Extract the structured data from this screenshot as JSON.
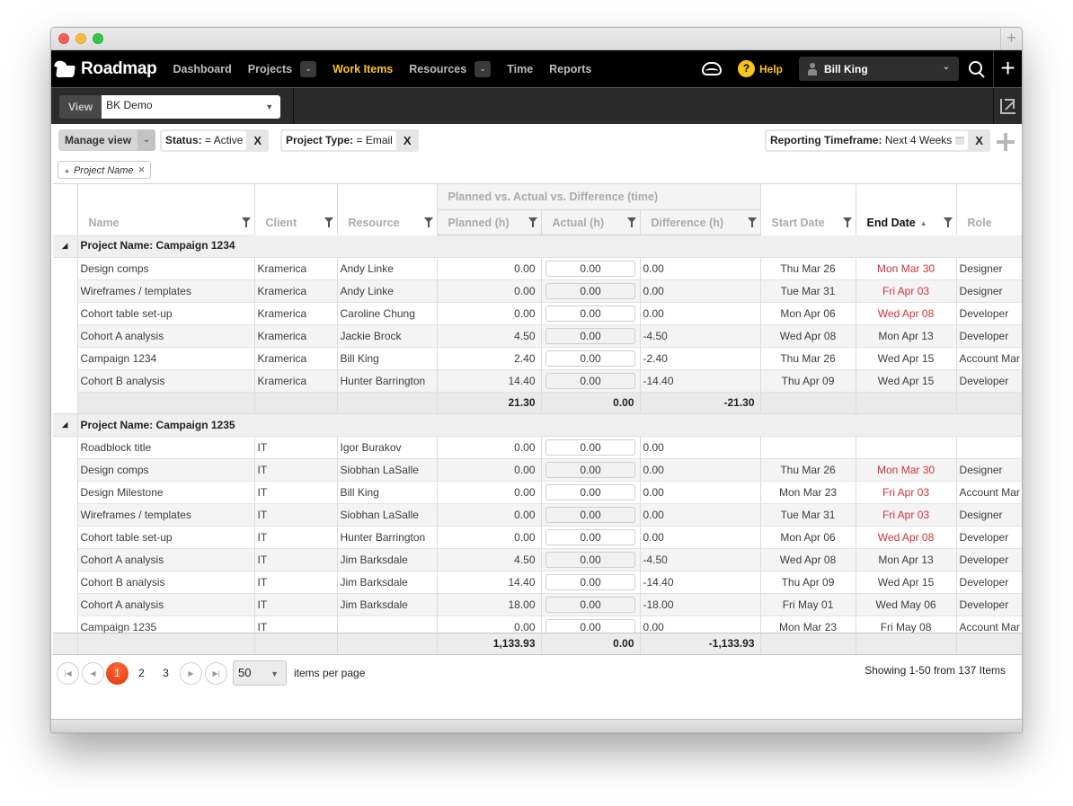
{
  "window": {
    "tab_plus": "+"
  },
  "nav": {
    "logo": "Roadmap",
    "items": [
      {
        "label": "Dashboard",
        "active": false,
        "dropdown": false
      },
      {
        "label": "Projects",
        "active": false,
        "dropdown": true
      },
      {
        "label": "Work Items",
        "active": true,
        "dropdown": false
      },
      {
        "label": "Resources",
        "active": false,
        "dropdown": true
      },
      {
        "label": "Time",
        "active": false,
        "dropdown": false
      },
      {
        "label": "Reports",
        "active": false,
        "dropdown": false
      }
    ],
    "help_badge": "?",
    "help_label": "Help",
    "user": "Bill King",
    "plus": "+",
    "colors": {
      "active": "#f8c51c",
      "bar": "#000000"
    }
  },
  "viewbar": {
    "label": "View",
    "selected": "BK Demo"
  },
  "filters": {
    "manage_view": "Manage view",
    "chips": [
      {
        "key": "Status:",
        "value": "= Active",
        "close": "X"
      },
      {
        "key": "Project Type:",
        "value": "= Email",
        "close": "X"
      },
      {
        "key": "Reporting Timeframe:",
        "value": "Next 4 Weeks",
        "close": "X"
      }
    ],
    "group_by": "Project Name",
    "group_close": "×"
  },
  "grid": {
    "group_header": "Planned vs. Actual vs. Difference (time)",
    "columns": {
      "name": "Name",
      "client": "Client",
      "resource": "Resource",
      "planned": "Planned (h)",
      "actual": "Actual (h)",
      "difference": "Difference (h)",
      "start": "Start Date",
      "end": "End Date",
      "role": "Role"
    },
    "sort_indicator": "▲",
    "groups": [
      {
        "title": "Project Name: Campaign 1234",
        "rows": [
          {
            "name": "Design comps",
            "client": "Kramerica",
            "resource": "Andy Linke",
            "planned": "0.00",
            "actual": "0.00",
            "difference": "0.00",
            "start": "Thu Mar 26",
            "end": "Mon Mar 30",
            "end_overdue": true,
            "role": "Designer"
          },
          {
            "name": "Wireframes / templates",
            "client": "Kramerica",
            "resource": "Andy Linke",
            "planned": "0.00",
            "actual": "0.00",
            "difference": "0.00",
            "start": "Tue Mar 31",
            "end": "Fri Apr 03",
            "end_overdue": true,
            "role": "Designer"
          },
          {
            "name": "Cohort table set-up",
            "client": "Kramerica",
            "resource": "Caroline Chung",
            "planned": "0.00",
            "actual": "0.00",
            "difference": "0.00",
            "start": "Mon Apr 06",
            "end": "Wed Apr 08",
            "end_overdue": true,
            "role": "Developer"
          },
          {
            "name": "Cohort A analysis",
            "client": "Kramerica",
            "resource": "Jackie Brock",
            "planned": "4.50",
            "actual": "0.00",
            "difference": "-4.50",
            "start": "Wed Apr 08",
            "end": "Mon Apr 13",
            "end_overdue": false,
            "role": "Developer"
          },
          {
            "name": "Campaign 1234",
            "client": "Kramerica",
            "resource": "Bill King",
            "planned": "2.40",
            "actual": "0.00",
            "difference": "-2.40",
            "start": "Thu Mar 26",
            "end": "Wed Apr 15",
            "end_overdue": false,
            "role": "Account Mar"
          },
          {
            "name": "Cohort B analysis",
            "client": "Kramerica",
            "resource": "Hunter Barrington",
            "planned": "14.40",
            "actual": "0.00",
            "difference": "-14.40",
            "start": "Thu Apr 09",
            "end": "Wed Apr 15",
            "end_overdue": false,
            "role": "Developer"
          }
        ],
        "subtotal": {
          "planned": "21.30",
          "actual": "0.00",
          "difference": "-21.30"
        }
      },
      {
        "title": "Project Name: Campaign 1235",
        "rows": [
          {
            "name": "Roadblock title",
            "client": "IT",
            "resource": "Igor Burakov",
            "planned": "0.00",
            "actual": "0.00",
            "difference": "0.00",
            "start": "",
            "end": "",
            "end_overdue": false,
            "role": ""
          },
          {
            "name": "Design comps",
            "client": "IT",
            "resource": "Siobhan LaSalle",
            "planned": "0.00",
            "actual": "0.00",
            "difference": "0.00",
            "start": "Thu Mar 26",
            "end": "Mon Mar 30",
            "end_overdue": true,
            "role": "Designer"
          },
          {
            "name": "Design Milestone",
            "client": "IT",
            "resource": "Bill King",
            "planned": "0.00",
            "actual": "0.00",
            "difference": "0.00",
            "start": "Mon Mar 23",
            "end": "Fri Apr 03",
            "end_overdue": true,
            "role": "Account Mar"
          },
          {
            "name": "Wireframes / templates",
            "client": "IT",
            "resource": "Siobhan LaSalle",
            "planned": "0.00",
            "actual": "0.00",
            "difference": "0.00",
            "start": "Tue Mar 31",
            "end": "Fri Apr 03",
            "end_overdue": true,
            "role": "Designer"
          },
          {
            "name": "Cohort table set-up",
            "client": "IT",
            "resource": "Hunter Barrington",
            "planned": "0.00",
            "actual": "0.00",
            "difference": "0.00",
            "start": "Mon Apr 06",
            "end": "Wed Apr 08",
            "end_overdue": true,
            "role": "Developer"
          },
          {
            "name": "Cohort A analysis",
            "client": "IT",
            "resource": "Jim Barksdale",
            "planned": "4.50",
            "actual": "0.00",
            "difference": "-4.50",
            "start": "Wed Apr 08",
            "end": "Mon Apr 13",
            "end_overdue": false,
            "role": "Developer"
          },
          {
            "name": "Cohort B analysis",
            "client": "IT",
            "resource": "Jim Barksdale",
            "planned": "14.40",
            "actual": "0.00",
            "difference": "-14.40",
            "start": "Thu Apr 09",
            "end": "Wed Apr 15",
            "end_overdue": false,
            "role": "Developer"
          },
          {
            "name": "Cohort A analysis",
            "client": "IT",
            "resource": "Jim Barksdale",
            "planned": "18.00",
            "actual": "0.00",
            "difference": "-18.00",
            "start": "Fri May 01",
            "end": "Wed May 06",
            "end_overdue": false,
            "role": "Developer"
          },
          {
            "name": "Campaign 1235",
            "client": "IT",
            "resource": "",
            "planned": "0.00",
            "actual": "0.00",
            "difference": "0.00",
            "start": "Mon Mar 23",
            "end": "Fri May 08",
            "end_overdue": false,
            "role": "Account Mar"
          }
        ]
      }
    ],
    "total": {
      "planned": "1,133.93",
      "actual": "0.00",
      "difference": "-1,133.93"
    },
    "colors": {
      "overdue": "#d0323c"
    }
  },
  "pager": {
    "first": "|◀",
    "prev": "◀",
    "next": "▶",
    "last": "▶|",
    "pages": [
      "1",
      "2",
      "3"
    ],
    "current_page": "1",
    "per_page": "50",
    "per_page_label": "items per page",
    "showing": "Showing 1-50 from 137 Items",
    "accent": "#ed3b14"
  }
}
